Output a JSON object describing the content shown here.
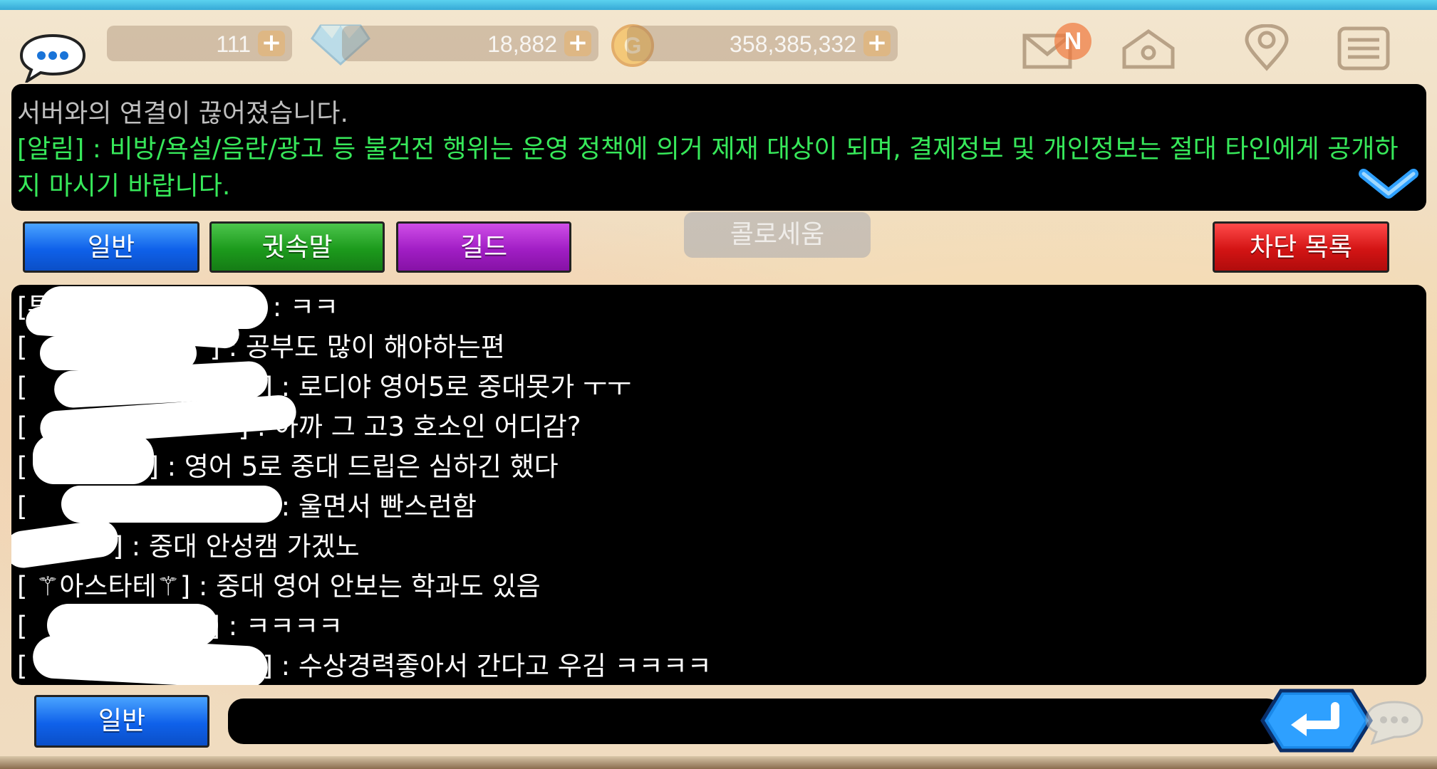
{
  "topbar": {
    "stamina": "111",
    "gems": "18,882",
    "gold": "358,385,332",
    "plus": "+",
    "mail_badge": "N",
    "icons": [
      "chat-bubble-icon",
      "heart-icon",
      "diamond-icon",
      "gold-coin-icon",
      "mail-icon",
      "house-icon",
      "map-pin-icon",
      "menu-icon"
    ]
  },
  "notice": {
    "system": "서버와의 연결이 끊어졌습니다.",
    "alert": "[알림] : 비방/욕설/음란/광고 등 불건전 행위는 운영 정책에 의거 제재 대상이 되며, 결제정보 및 개인정보는 절대 타인에게 공개하지 마시기 바랍니다."
  },
  "tabs": {
    "general": "일반",
    "whisper": "귓속말",
    "guild": "길드",
    "block_list": "차단 목록"
  },
  "background_label": "콜로세움",
  "messages": [
    {
      "name": "[투",
      "text": "이] : ㅋㅋ"
    },
    {
      "name": "[",
      "text": "] : 공부도 많이 해야하는편"
    },
    {
      "name": "[",
      "text": "] : 로디야 영어5로 중대못가 ㅜㅜ"
    },
    {
      "name": "[",
      "text": "] : 아까 그 고3 호소인 어디감?"
    },
    {
      "name": "[",
      "text": "] : 영어 5로 중대 드립은 심하긴 했다"
    },
    {
      "name": "[",
      "text": "] : 울면서 빤스런함"
    },
    {
      "name": "[",
      "text": "] : 중대 안성캠 가겠노"
    },
    {
      "name": "[ ⚚아스타테⚚]",
      "text": " : 중대 영어 안보는 학과도 있음"
    },
    {
      "name": "[",
      "text": "] : ㅋㅋㅋㅋ"
    },
    {
      "name": "[",
      "text": "] : 수상경력좋아서 간다고 우김 ㅋㅋㅋㅋ"
    }
  ],
  "input": {
    "channel": "일반",
    "value": "",
    "placeholder": ""
  },
  "colors": {
    "alert_text": "#37e85a",
    "system_text": "#bfbfbf",
    "tab_blue": "#0f61ea",
    "tab_green": "#1c9a1c",
    "tab_purple": "#a11ec4",
    "tab_red": "#d31414"
  }
}
